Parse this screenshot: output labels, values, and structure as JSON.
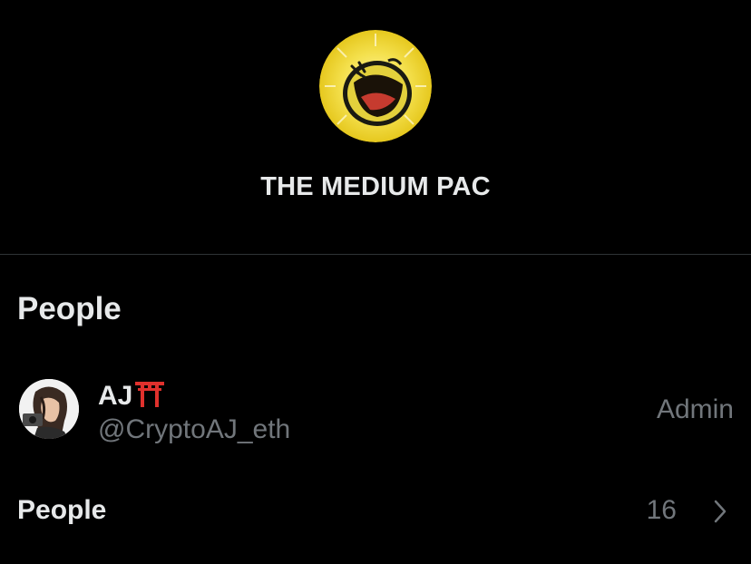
{
  "group": {
    "name": "THE MEDIUM PAC",
    "avatar_icon": "yellow-cartoon-frog-avatar"
  },
  "people_section": {
    "heading": "People",
    "members": [
      {
        "display_name": "AJ",
        "name_emoji": "torii-gate-icon",
        "handle": "@CryptoAJ_eth",
        "role": "Admin",
        "avatar_icon": "illustrated-character-avatar"
      }
    ]
  },
  "people_row": {
    "label": "People",
    "count": "16",
    "chevron_icon": "chevron-right-icon"
  },
  "colors": {
    "background": "#000000",
    "primary_text": "#e7e9ea",
    "secondary_text": "#71767b",
    "divider": "#2f3336",
    "accent_yellow": "#f4e04d",
    "torii_red": "#e0312d"
  }
}
